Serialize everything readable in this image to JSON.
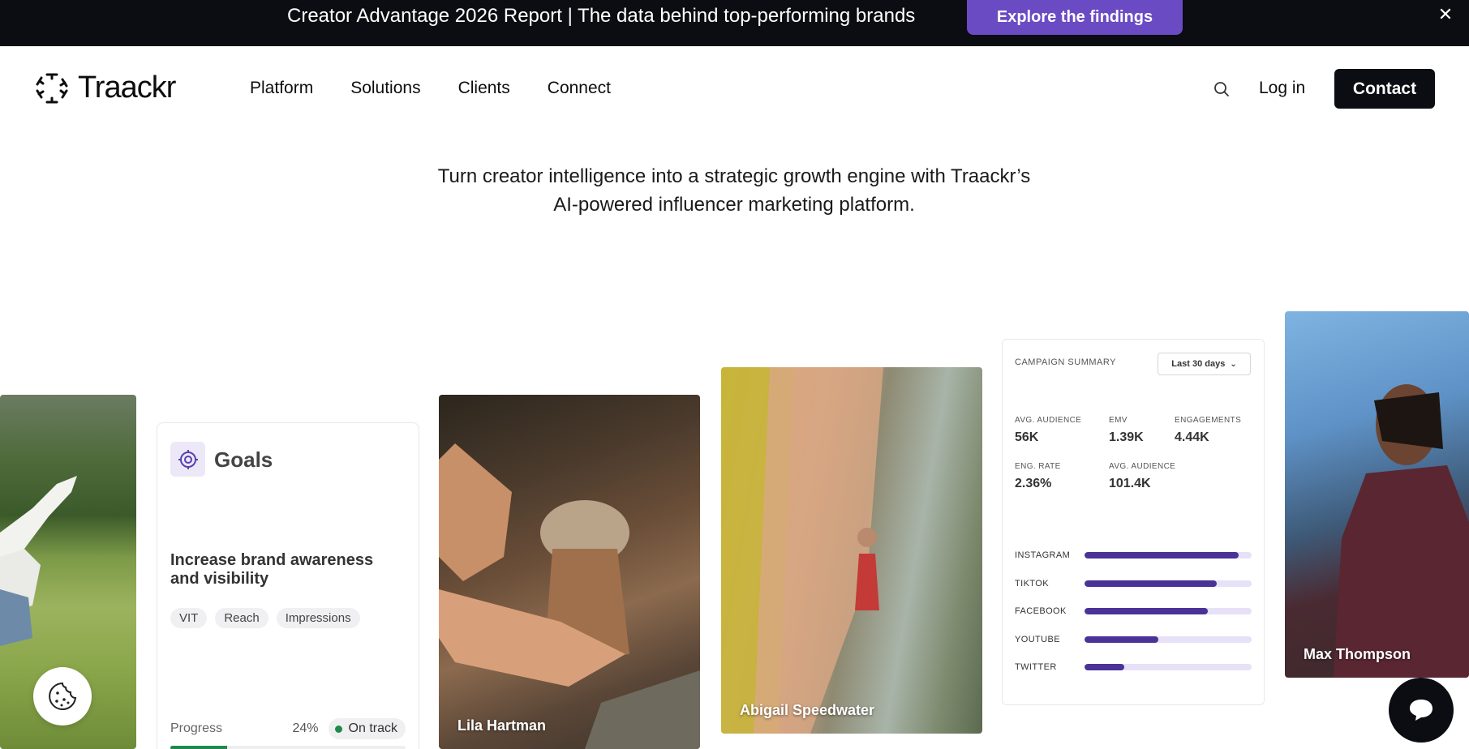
{
  "announcement": {
    "text": "Creator Advantage 2026 Report | The data behind top-performing brands",
    "cta_label": "Explore the findings",
    "close_icon": "close-icon"
  },
  "header": {
    "logo_text": "Traackr",
    "nav": [
      "Platform",
      "Solutions",
      "Clients",
      "Connect"
    ],
    "login_label": "Log in",
    "contact_label": "Contact"
  },
  "hero": {
    "line1": "Turn creator intelligence into a strategic growth engine with Traackr’s",
    "line2": "AI-powered influencer marketing platform."
  },
  "cards": {
    "lila_name": "Lila Hartman",
    "abigail_name": "Abigail Speedwater",
    "max_name": "Max Thompson",
    "goals": {
      "title": "Goals",
      "description": "Increase brand awareness and visibility",
      "tags": [
        "VIT",
        "Reach",
        "Impressions"
      ],
      "progress_label": "Progress",
      "progress_percent": "24%",
      "progress_value": 0.24,
      "status": "On track"
    },
    "summary": {
      "title": "CAMPAIGN SUMMARY",
      "range": "Last 30 days",
      "metrics": [
        {
          "label": "AVG. AUDIENCE",
          "value": "56K"
        },
        {
          "label": "EMV",
          "value": "1.39K"
        },
        {
          "label": "ENGAGEMENTS",
          "value": "4.44K"
        },
        {
          "label": "ENG. RATE",
          "value": "2.36%"
        },
        {
          "label": "AVG. AUDIENCE",
          "value": "101.4K"
        }
      ],
      "platforms": [
        {
          "label": "INSTAGRAM",
          "value": 0.92
        },
        {
          "label": "TIKTOK",
          "value": 0.79
        },
        {
          "label": "FACEBOOK",
          "value": 0.74
        },
        {
          "label": "YOUTUBE",
          "value": 0.44
        },
        {
          "label": "TWITTER",
          "value": 0.24
        }
      ]
    }
  },
  "colors": {
    "accent_purple": "#6a4bc4",
    "bar_purple": "#4a3296",
    "dark": "#0b0d12",
    "success_green": "#1f8a4c"
  }
}
